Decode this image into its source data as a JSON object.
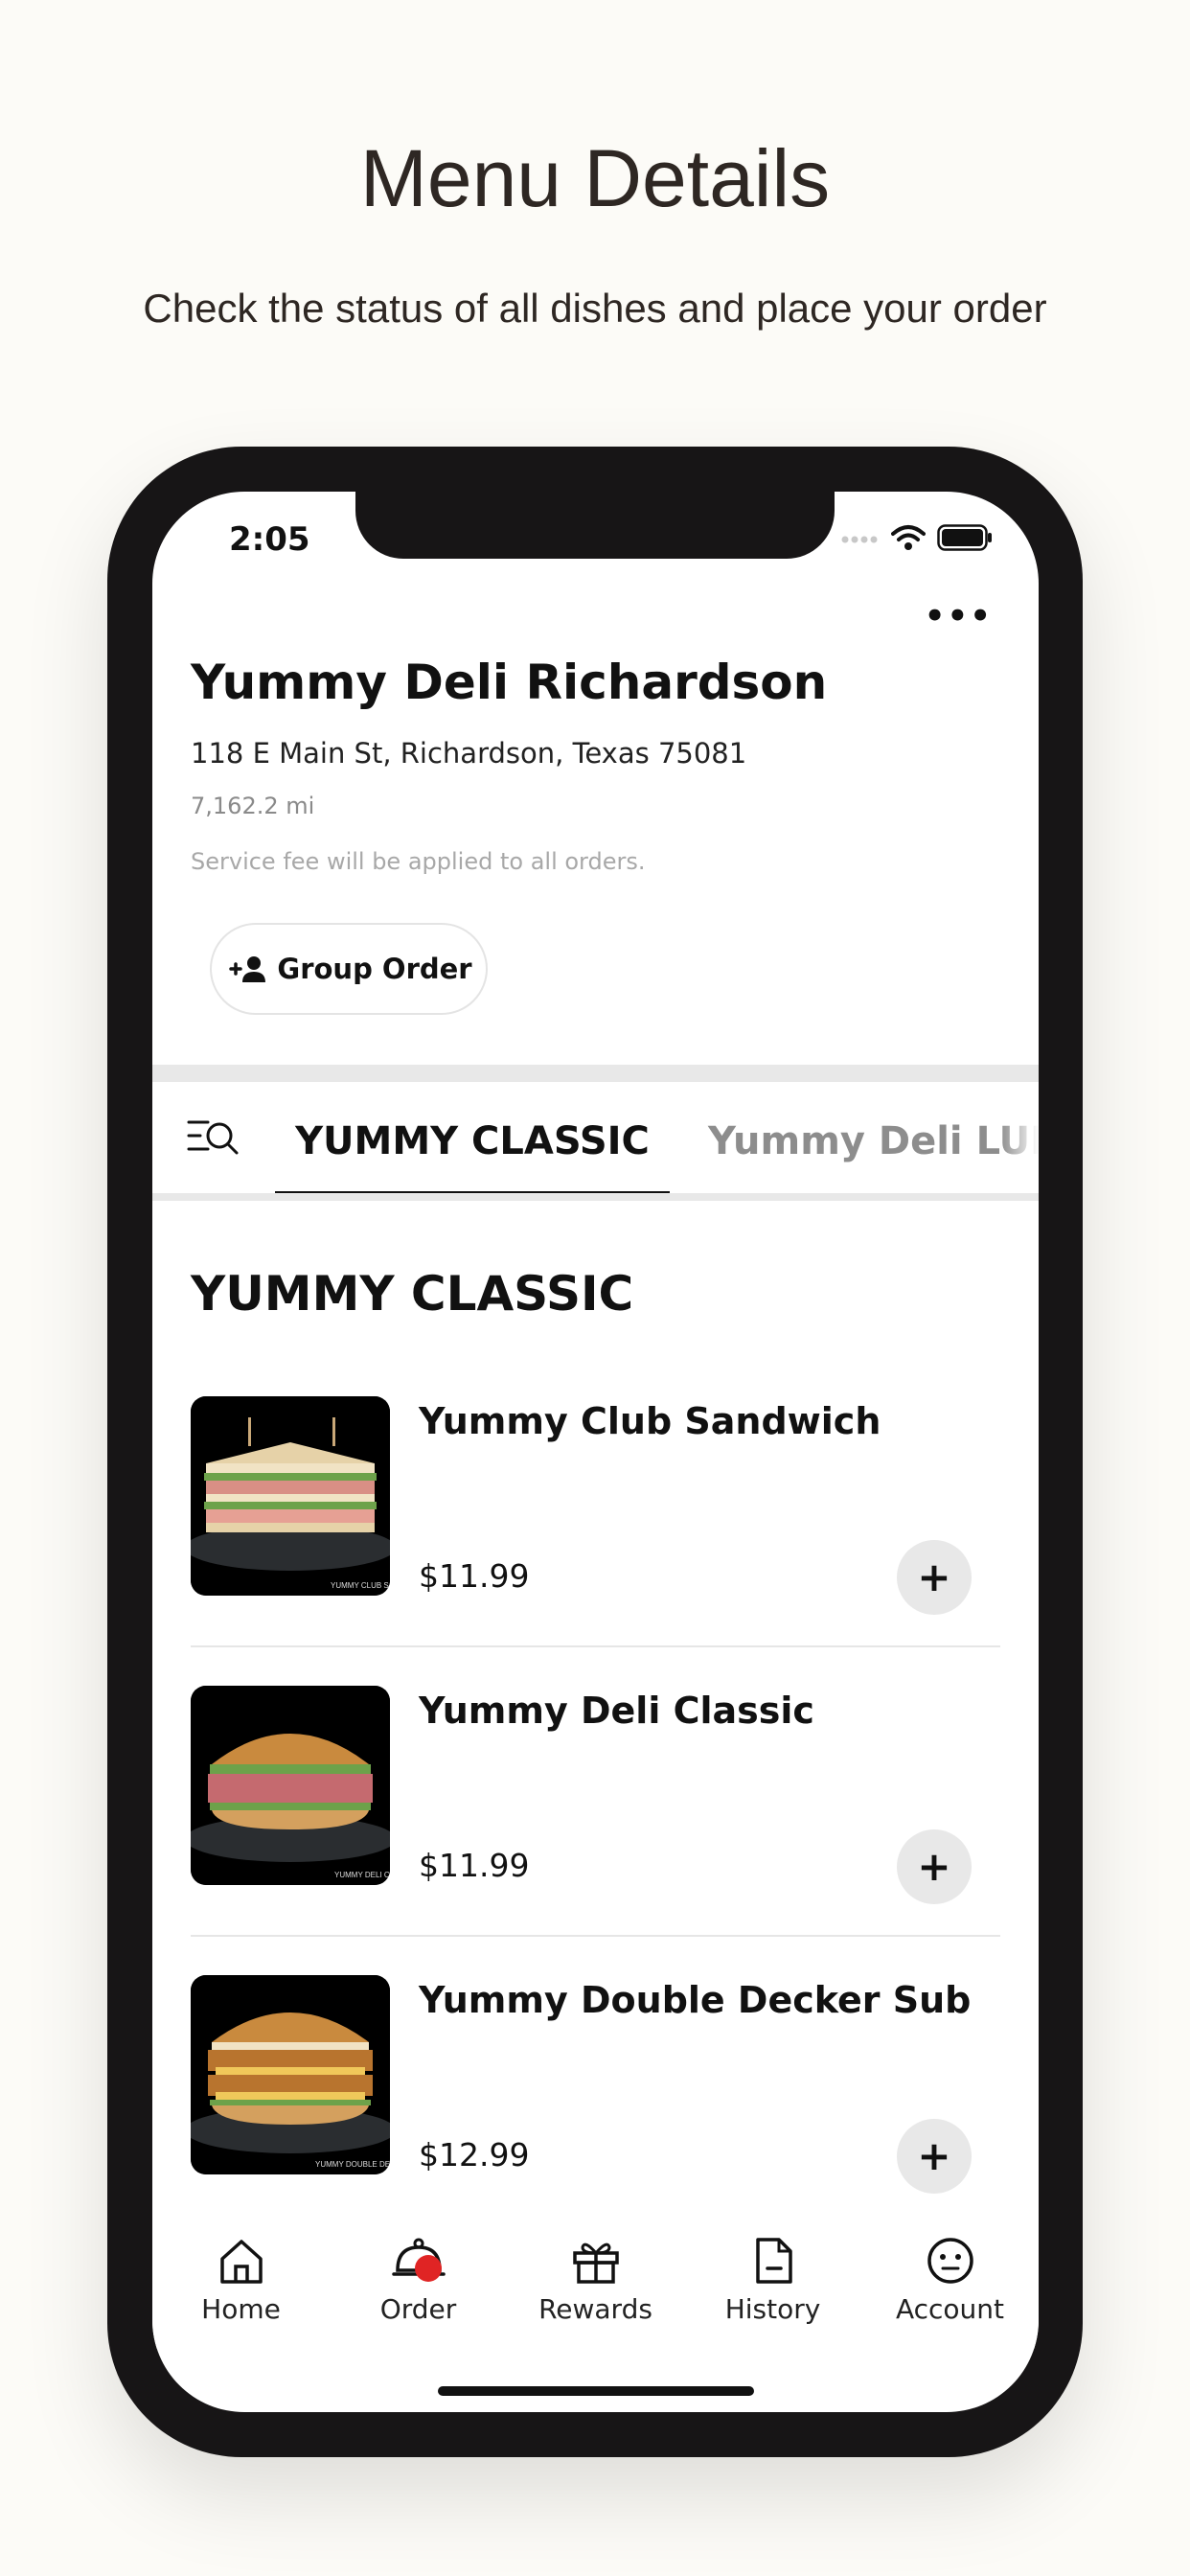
{
  "hero": {
    "title": "Menu Details",
    "subtitle": "Check the status of all dishes and place your order"
  },
  "status_bar": {
    "time": "2:05"
  },
  "header": {
    "more_label": "•••"
  },
  "store": {
    "name": "Yummy Deli Richardson",
    "address": "118 E Main St, Richardson, Texas 75081",
    "distance": "7,162.2 mi",
    "fee_note": "Service fee will be applied to all orders.",
    "group_order_label": "Group Order"
  },
  "tabs": {
    "active": "YUMMY CLASSIC",
    "inactive": "Yummy Deli LUNCH"
  },
  "section": {
    "title": "YUMMY CLASSIC"
  },
  "items": [
    {
      "name": "Yummy Club Sandwich",
      "price": "$11.99",
      "img_caption": "YUMMY CLUB SAN"
    },
    {
      "name": "Yummy Deli Classic",
      "price": "$11.99",
      "img_caption": "YUMMY DELI CL"
    },
    {
      "name": "Yummy Double Decker Sub",
      "price": "$12.99",
      "img_caption": "YUMMY DOUBLE DECK"
    }
  ],
  "add_label": "+",
  "nav": [
    {
      "label": "Home",
      "icon": "home-icon"
    },
    {
      "label": "Order",
      "icon": "cloche-icon"
    },
    {
      "label": "Rewards",
      "icon": "gift-icon"
    },
    {
      "label": "History",
      "icon": "document-icon"
    },
    {
      "label": "Account",
      "icon": "account-icon"
    }
  ],
  "colors": {
    "background": "#fcfbf7",
    "phone_frame": "#171516",
    "accent_red": "#e02424",
    "inactive_gray": "#8d8d8d"
  }
}
